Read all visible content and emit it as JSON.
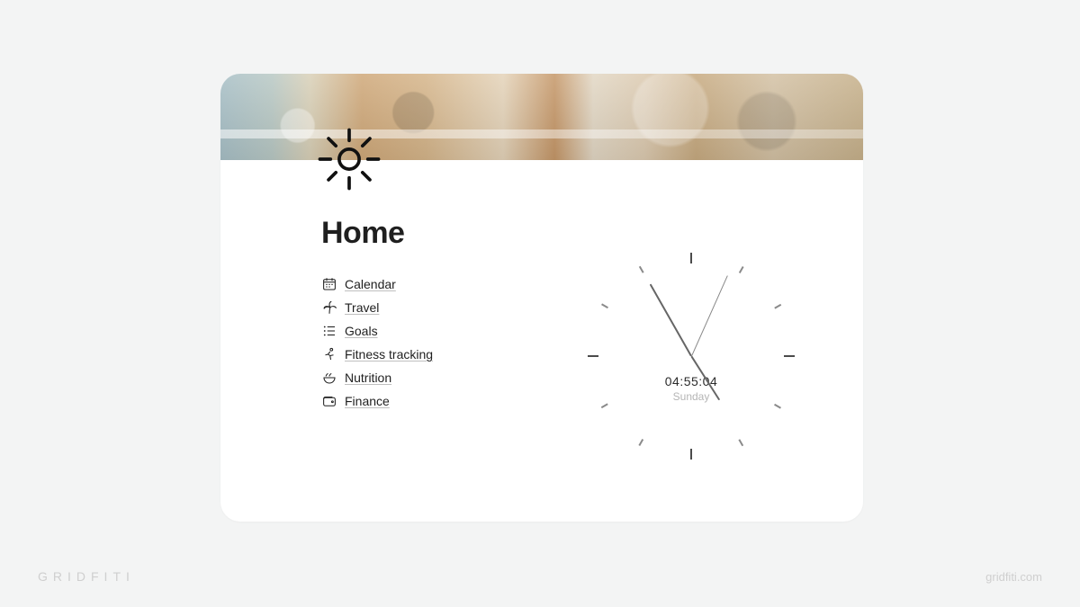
{
  "page": {
    "title": "Home",
    "icon": "sun-icon"
  },
  "links": [
    {
      "icon": "calendar-icon",
      "label": "Calendar"
    },
    {
      "icon": "palm-tree-icon",
      "label": "Travel"
    },
    {
      "icon": "list-icon",
      "label": "Goals"
    },
    {
      "icon": "running-icon",
      "label": "Fitness tracking"
    },
    {
      "icon": "bowl-icon",
      "label": "Nutrition"
    },
    {
      "icon": "wallet-icon",
      "label": "Finance"
    }
  ],
  "clock": {
    "time": "04:55:04",
    "day": "Sunday",
    "hours": 4,
    "minutes": 55,
    "seconds": 4
  },
  "branding": {
    "left": "GRIDFITI",
    "right": "gridfiti.com"
  }
}
